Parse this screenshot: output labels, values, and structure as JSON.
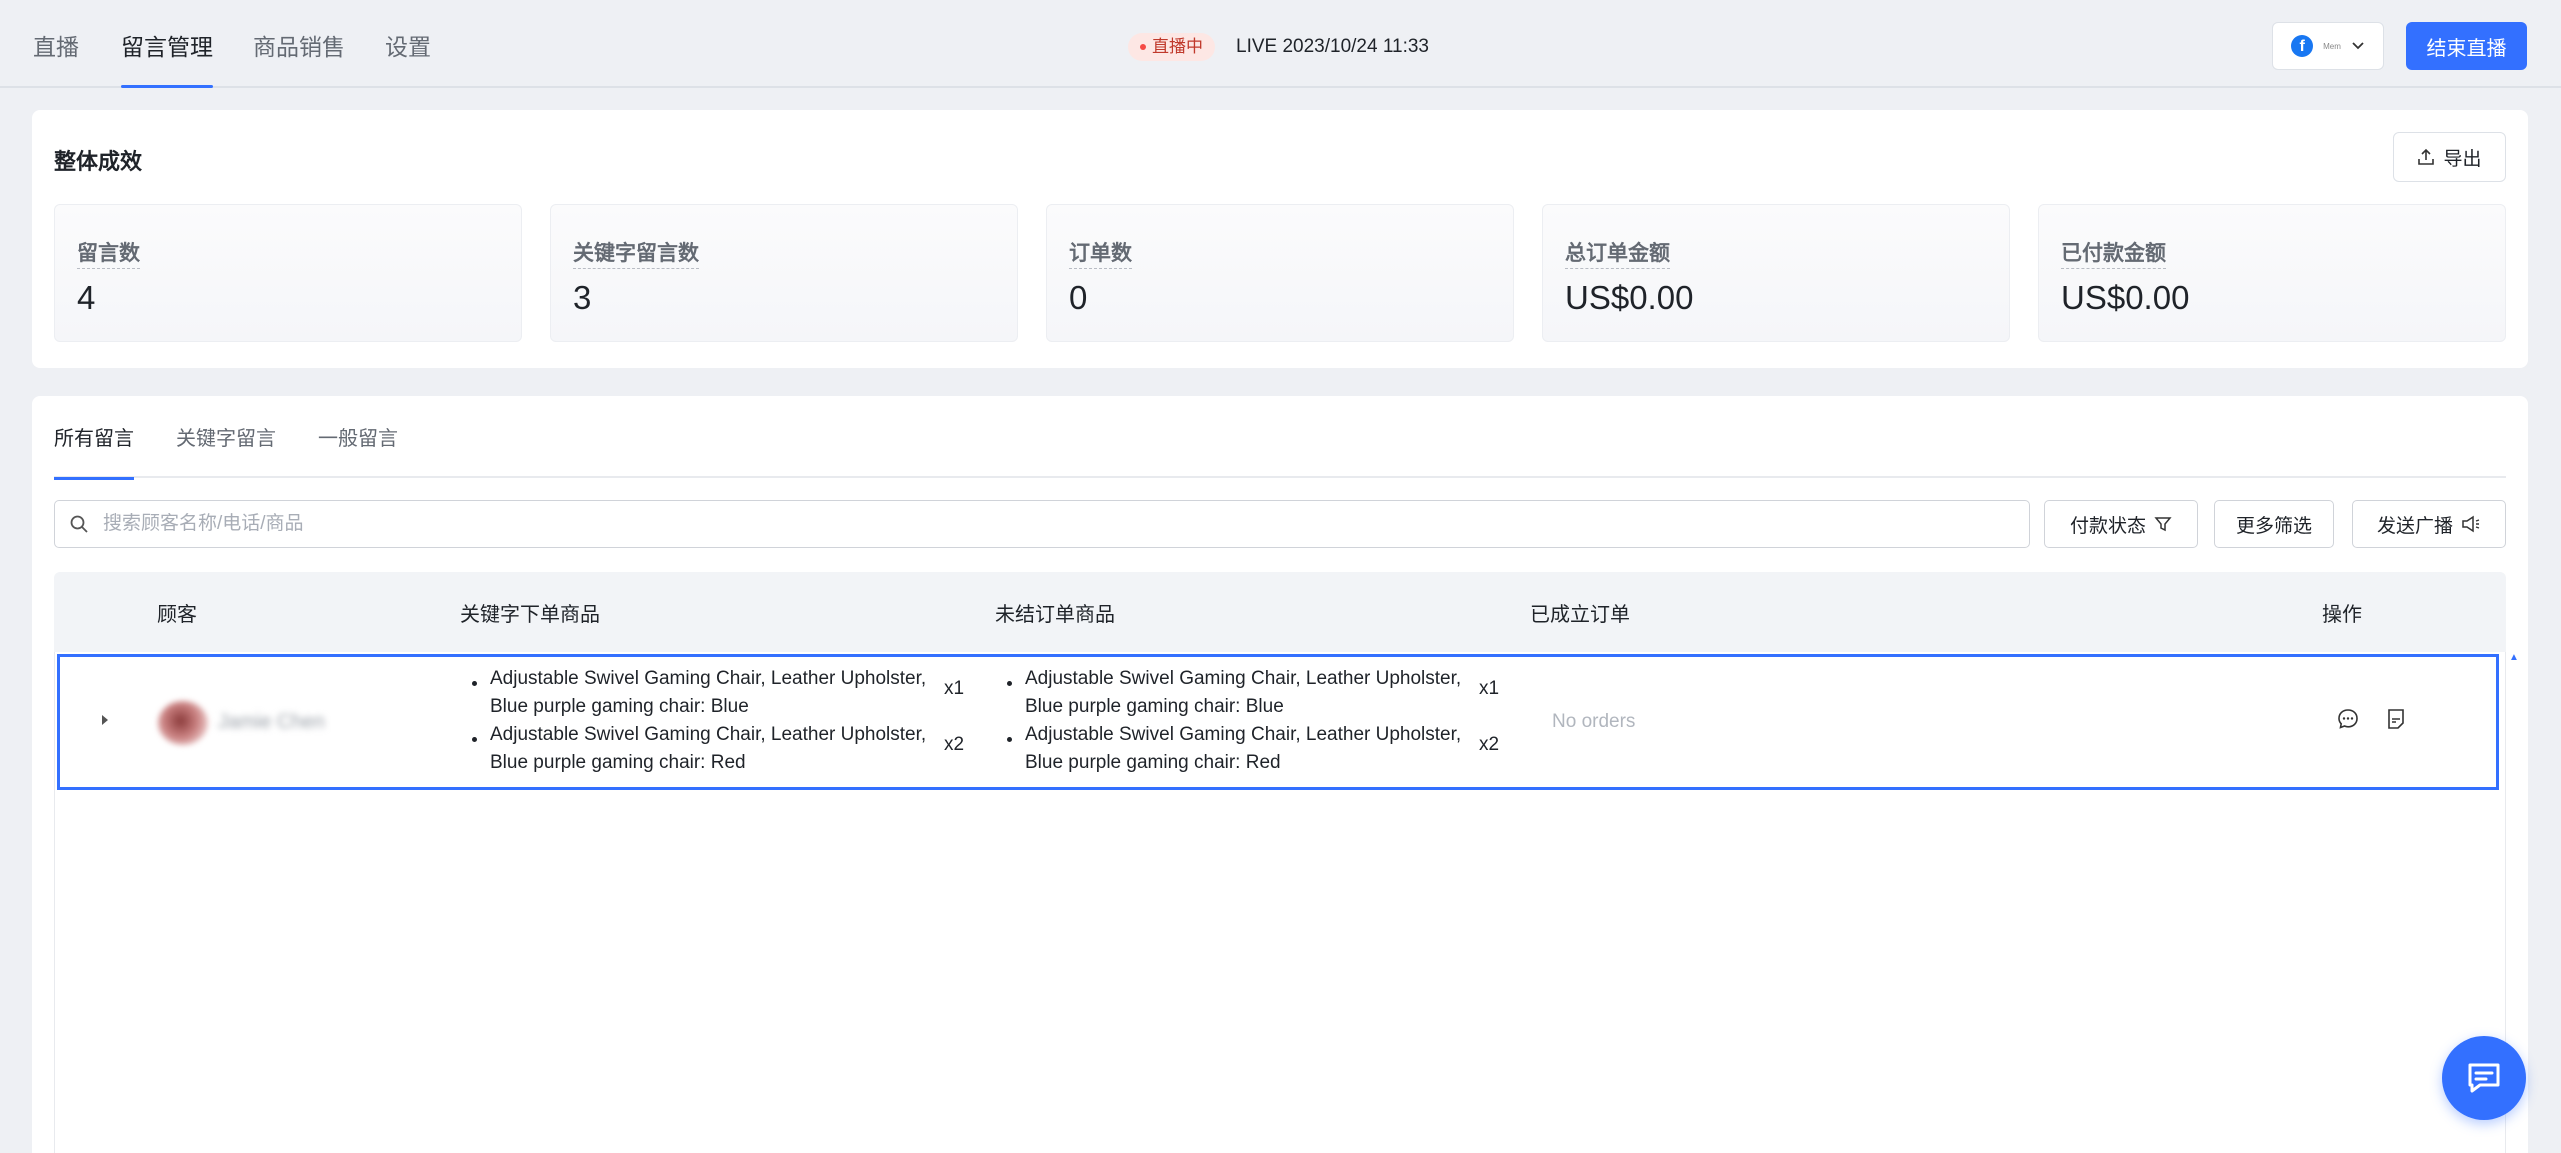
{
  "top_nav": {
    "tabs": [
      {
        "label": "直播"
      },
      {
        "label": "留言管理"
      },
      {
        "label": "商品销售"
      },
      {
        "label": "设置"
      }
    ],
    "live_status": "直播中",
    "live_time": "LIVE 2023/10/24 11:33",
    "page_name": "Mem",
    "end_button": "结束直播",
    "colors": {
      "accent": "#3370ff",
      "live_badge_bg": "#fde7e4"
    }
  },
  "overview": {
    "title": "整体成效",
    "export_label": "导出",
    "metrics": [
      {
        "label": "留言数",
        "value": "4"
      },
      {
        "label": "关键字留言数",
        "value": "3"
      },
      {
        "label": "订单数",
        "value": "0"
      },
      {
        "label": "总订单金额",
        "value": "US$0.00"
      },
      {
        "label": "已付款金额",
        "value": "US$0.00"
      }
    ]
  },
  "comments": {
    "tabs": [
      {
        "label": "所有留言"
      },
      {
        "label": "关键字留言"
      },
      {
        "label": "一般留言"
      }
    ],
    "search_placeholder": "搜索顾客名称/电话/商品",
    "filters": {
      "payment_status": "付款状态",
      "more_filters": "更多筛选",
      "send_broadcast": "发送广播"
    },
    "columns": {
      "customer": "顾客",
      "keyword_products": "关键字下单商品",
      "pending_products": "未结订单商品",
      "orders": "已成立订单",
      "actions": "操作"
    },
    "rows": [
      {
        "customer_name": "Jamie Chen",
        "keyword_products": [
          {
            "name": "Adjustable Swivel Gaming Chair, Leather Upholster, Blue purple gaming chair: Blue",
            "qty": "x1"
          },
          {
            "name": "Adjustable Swivel Gaming Chair, Leather Upholster, Blue purple gaming chair: Red",
            "qty": "x2"
          }
        ],
        "pending_products": [
          {
            "name": "Adjustable Swivel Gaming Chair, Leather Upholster, Blue purple gaming chair: Blue",
            "qty": "x1"
          },
          {
            "name": "Adjustable Swivel Gaming Chair, Leather Upholster, Blue purple gaming chair: Red",
            "qty": "x2"
          }
        ],
        "orders": "No orders"
      }
    ]
  },
  "icons": {
    "search": "search-icon",
    "filter": "filter-icon",
    "megaphone": "megaphone-icon",
    "export": "upload-icon",
    "chat": "chat-bubble-icon",
    "note": "note-icon",
    "support": "support-chat-icon"
  }
}
